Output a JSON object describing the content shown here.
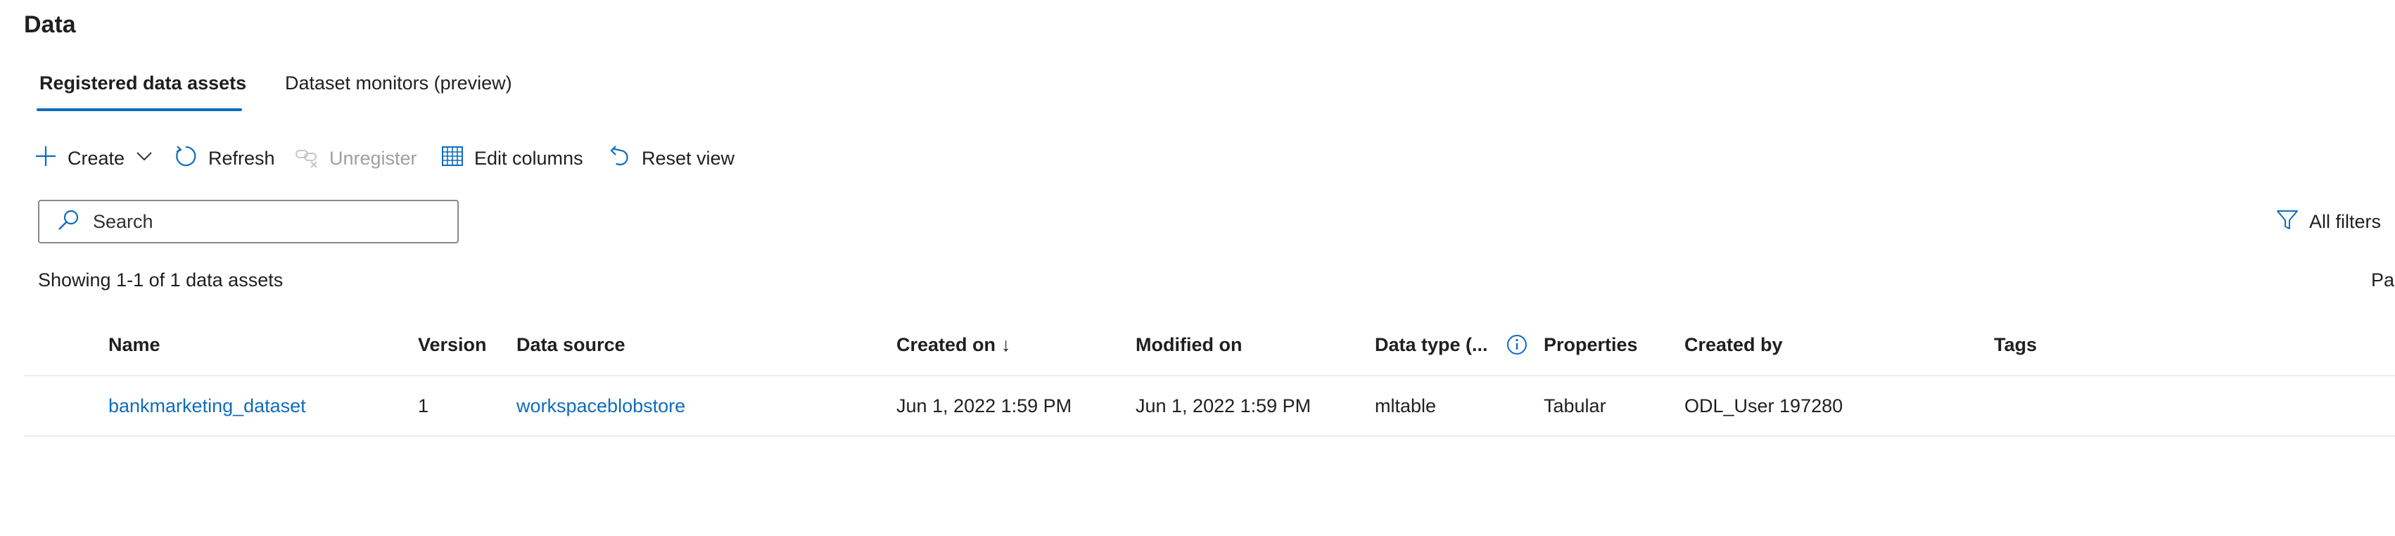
{
  "page": {
    "title": "Data"
  },
  "tabs": [
    {
      "label": "Registered data assets",
      "active": true
    },
    {
      "label": "Dataset monitors (preview)",
      "active": false
    }
  ],
  "toolbar": {
    "create": "Create",
    "refresh": "Refresh",
    "unregister": "Unregister",
    "edit_columns": "Edit columns",
    "reset_view": "Reset view"
  },
  "search": {
    "placeholder": "Search",
    "value": ""
  },
  "filters": {
    "label": "All filters"
  },
  "summary": {
    "showing": "Showing 1-1 of 1 data assets",
    "pagination_partial": "Pag"
  },
  "table": {
    "headers": {
      "name": "Name",
      "version": "Version",
      "data_source": "Data source",
      "created_on": "Created on",
      "created_on_sort": "↓",
      "modified_on": "Modified on",
      "data_type": "Data type (...",
      "properties": "Properties",
      "created_by": "Created by",
      "tags": "Tags"
    },
    "rows": [
      {
        "name": "bankmarketing_dataset",
        "version": "1",
        "data_source": "workspaceblobstore",
        "created_on": "Jun 1, 2022 1:59 PM",
        "modified_on": "Jun 1, 2022 1:59 PM",
        "data_type": "mltable",
        "properties": "Tabular",
        "created_by": "ODL_User 197280",
        "tags": ""
      }
    ]
  },
  "colors": {
    "accent": "#0f6cbd",
    "text": "#201f1e",
    "disabled": "#a19f9d",
    "divider": "#edebe9"
  }
}
